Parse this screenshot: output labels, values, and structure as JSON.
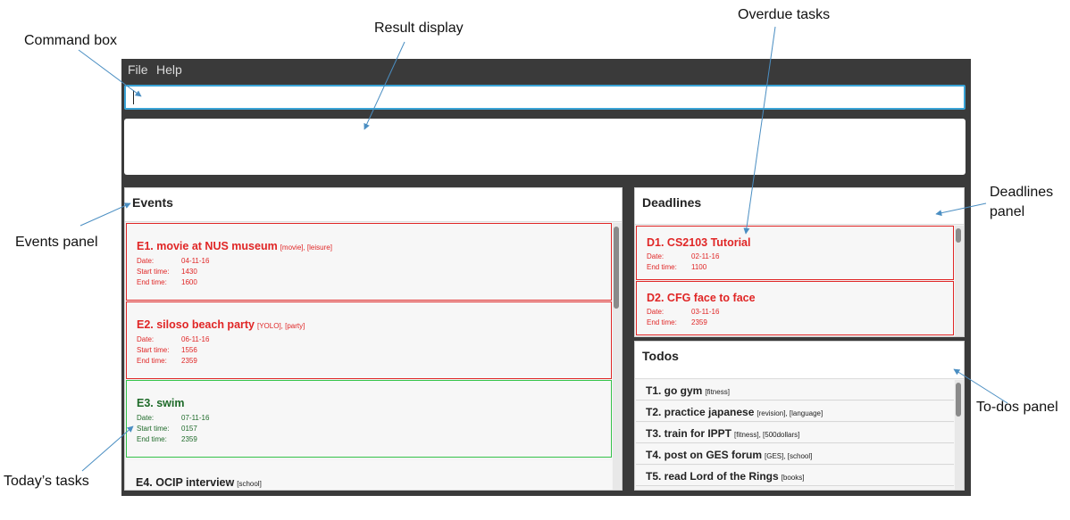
{
  "callouts": {
    "command_box": "Command box",
    "result_display": "Result display",
    "overdue_tasks": "Overdue tasks",
    "deadlines_panel_line1": "Deadlines",
    "deadlines_panel_line2": "panel",
    "events_panel": "Events panel",
    "todos_panel": "To-dos panel",
    "todays_tasks": "Today’s tasks"
  },
  "menu": {
    "file": "File",
    "help": "Help"
  },
  "command_box": {
    "value": ""
  },
  "result_display": {
    "text": ""
  },
  "events": {
    "title": "Events",
    "items": [
      {
        "name": "E1. movie at NUS museum",
        "tags": "[movie], [leisure]",
        "date_label": "Date:",
        "date": "04-11-16",
        "start_label": "Start time:",
        "start": "1430",
        "end_label": "End time:",
        "end": "1600"
      },
      {
        "name": "E2. siloso beach party",
        "tags": "[YOLO], [party]",
        "date_label": "Date:",
        "date": "06-11-16",
        "start_label": "Start time:",
        "start": "1556",
        "end_label": "End time:",
        "end": "2359"
      },
      {
        "name": "E3. swim",
        "tags": "",
        "date_label": "Date:",
        "date": "07-11-16",
        "start_label": "Start time:",
        "start": "0157",
        "end_label": "End time:",
        "end": "2359"
      },
      {
        "name": "E4. OCIP interview",
        "tags": "[school]"
      }
    ]
  },
  "deadlines": {
    "title": "Deadlines",
    "items": [
      {
        "name": "D1. CS2103 Tutorial",
        "date_label": "Date:",
        "date": "02-11-16",
        "end_label": "End time:",
        "end": "1100"
      },
      {
        "name": "D2. CFG face to face",
        "date_label": "Date:",
        "date": "03-11-16",
        "end_label": "End time:",
        "end": "2359"
      }
    ]
  },
  "todos": {
    "title": "Todos",
    "items": [
      {
        "name": "T1. go gym",
        "tags": "[fitness]"
      },
      {
        "name": "T2. practice japanese",
        "tags": "[revision], [language]"
      },
      {
        "name": "T3. train for IPPT",
        "tags": "[fitness], [500dollars]"
      },
      {
        "name": "T4. post on GES forum",
        "tags": "[GES], [school]"
      },
      {
        "name": "T5. read Lord of the Rings",
        "tags": "[books]"
      }
    ]
  },
  "colors": {
    "overdue": "#e02626",
    "today": "#1f6b2a",
    "accent": "#3aa3d6",
    "window_bg": "#3a3a3a"
  }
}
